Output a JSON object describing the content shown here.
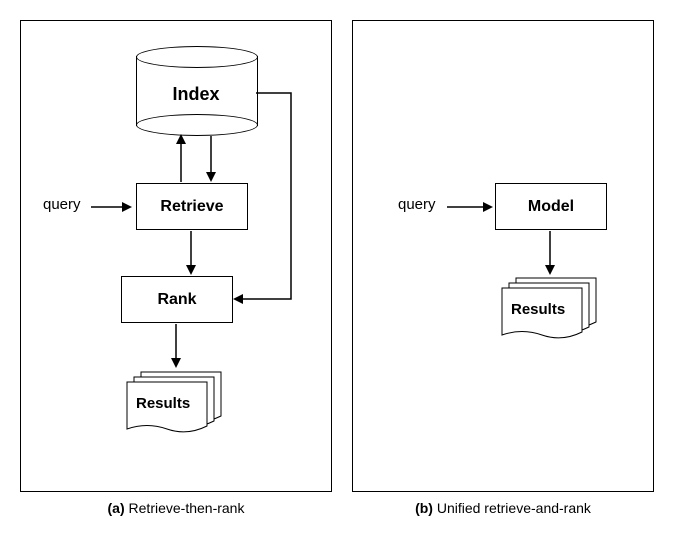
{
  "panelA": {
    "caption_bold": "(a)",
    "caption_text": " Retrieve-then-rank",
    "index_label": "Index",
    "query_label": "query",
    "retrieve_label": "Retrieve",
    "rank_label": "Rank",
    "results_label": "Results"
  },
  "panelB": {
    "caption_bold": "(b)",
    "caption_text": " Unified retrieve-and-rank",
    "query_label": "query",
    "model_label": "Model",
    "results_label": "Results"
  }
}
